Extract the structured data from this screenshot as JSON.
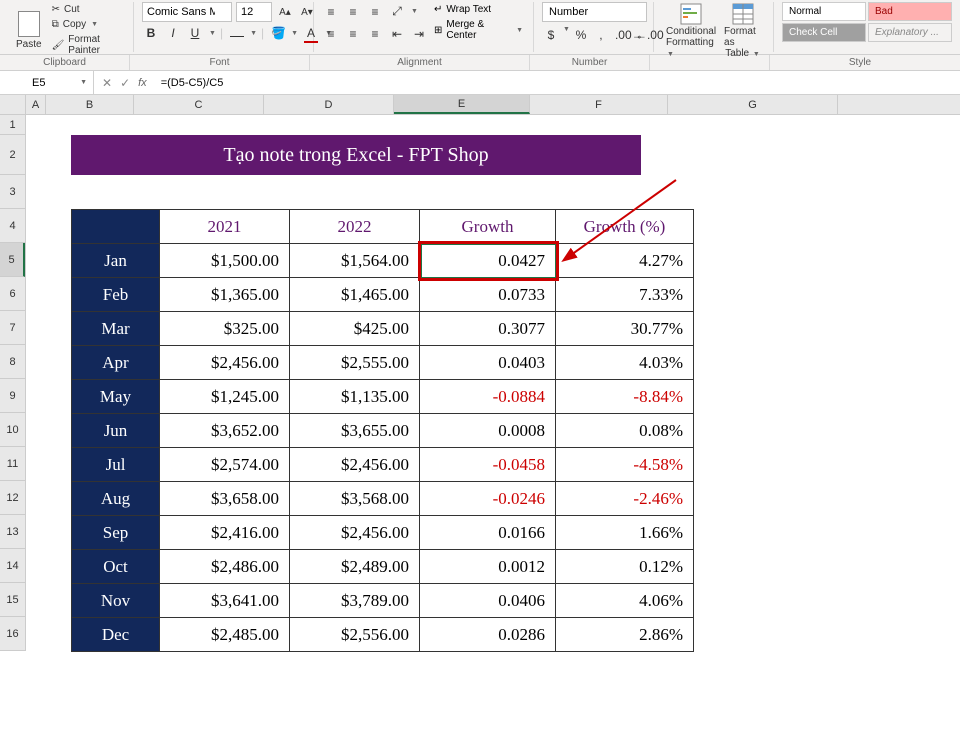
{
  "ribbon": {
    "paste": "Paste",
    "cut": "Cut",
    "copy": "Copy",
    "format_painter": "Format Painter",
    "clipboard_label": "Clipboard",
    "font_name": "Comic Sans MS",
    "font_size": "12",
    "font_label": "Font",
    "wrap_text": "Wrap Text",
    "merge_center": "Merge & Center",
    "alignment_label": "Alignment",
    "number_format": "Number",
    "number_label": "Number",
    "cond_fmt": "Conditional",
    "cond_fmt2": "Formatting",
    "fmt_table": "Format as",
    "fmt_table2": "Table",
    "style_normal": "Normal",
    "style_bad": "Bad",
    "style_check": "Check Cell",
    "style_exp": "Explanatory ...",
    "styles_label": "Style"
  },
  "formula": {
    "cell_ref": "E5",
    "formula": "=(D5-C5)/C5"
  },
  "columns": [
    "A",
    "B",
    "C",
    "D",
    "E",
    "F",
    "G"
  ],
  "rows": [
    "1",
    "2",
    "3",
    "4",
    "5",
    "6",
    "7",
    "8",
    "9",
    "10",
    "11",
    "12",
    "13",
    "14",
    "15",
    "16"
  ],
  "title": "Tạo note trong Excel - FPT Shop",
  "headers": {
    "y2021": "2021",
    "y2022": "2022",
    "growth": "Growth",
    "growthp": "Growth (%)"
  },
  "data": [
    {
      "m": "Jan",
      "a": "$1,500.00",
      "b": "$1,564.00",
      "g": "0.0427",
      "p": "4.27%",
      "neg": false
    },
    {
      "m": "Feb",
      "a": "$1,365.00",
      "b": "$1,465.00",
      "g": "0.0733",
      "p": "7.33%",
      "neg": false
    },
    {
      "m": "Mar",
      "a": "$325.00",
      "b": "$425.00",
      "g": "0.3077",
      "p": "30.77%",
      "neg": false
    },
    {
      "m": "Apr",
      "a": "$2,456.00",
      "b": "$2,555.00",
      "g": "0.0403",
      "p": "4.03%",
      "neg": false
    },
    {
      "m": "May",
      "a": "$1,245.00",
      "b": "$1,135.00",
      "g": "-0.0884",
      "p": "-8.84%",
      "neg": true
    },
    {
      "m": "Jun",
      "a": "$3,652.00",
      "b": "$3,655.00",
      "g": "0.0008",
      "p": "0.08%",
      "neg": false
    },
    {
      "m": "Jul",
      "a": "$2,574.00",
      "b": "$2,456.00",
      "g": "-0.0458",
      "p": "-4.58%",
      "neg": true
    },
    {
      "m": "Aug",
      "a": "$3,658.00",
      "b": "$3,568.00",
      "g": "-0.0246",
      "p": "-2.46%",
      "neg": true
    },
    {
      "m": "Sep",
      "a": "$2,416.00",
      "b": "$2,456.00",
      "g": "0.0166",
      "p": "1.66%",
      "neg": false
    },
    {
      "m": "Oct",
      "a": "$2,486.00",
      "b": "$2,489.00",
      "g": "0.0012",
      "p": "0.12%",
      "neg": false
    },
    {
      "m": "Nov",
      "a": "$3,641.00",
      "b": "$3,789.00",
      "g": "0.0406",
      "p": "4.06%",
      "neg": false
    },
    {
      "m": "Dec",
      "a": "$2,485.00",
      "b": "$2,556.00",
      "g": "0.0286",
      "p": "2.86%",
      "neg": false
    }
  ]
}
